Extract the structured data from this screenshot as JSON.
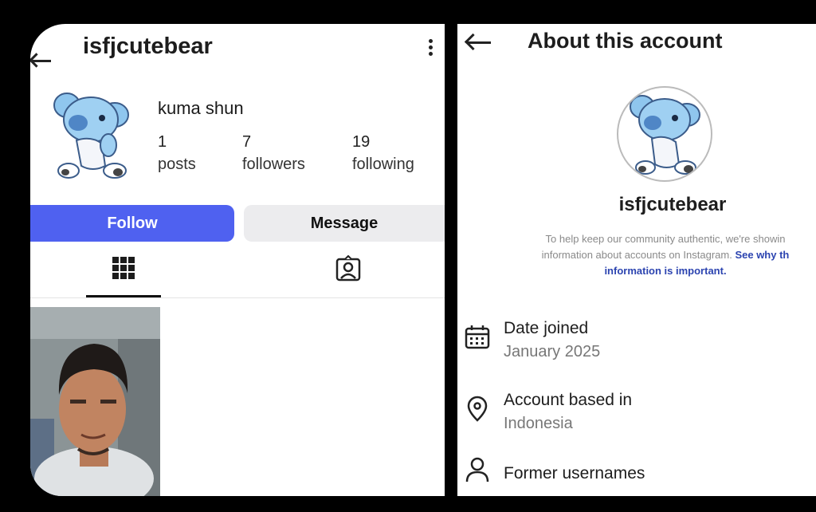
{
  "profile": {
    "username": "isfjcutebear",
    "display_name": "kuma shun",
    "stats": [
      {
        "count": "1",
        "label": "posts"
      },
      {
        "count": "7",
        "label": "followers"
      },
      {
        "count": "19",
        "label": "following"
      }
    ],
    "follow_label": "Follow",
    "message_label": "Message",
    "accent_color": "#4f61f0"
  },
  "about": {
    "title": "About this account",
    "username": "isfjcutebear",
    "info_line1": "To help keep our community authentic, we're showin",
    "info_line2": "information about accounts on Instagram.",
    "info_link_part1": "See why th",
    "info_link_part2": "information is important.",
    "rows": [
      {
        "title": "Date joined",
        "value": "January 2025",
        "icon": "calendar-icon"
      },
      {
        "title": "Account based in",
        "value": "Indonesia",
        "icon": "location-pin-icon"
      },
      {
        "title": "Former usernames",
        "value": "",
        "icon": "person-icon"
      }
    ]
  }
}
